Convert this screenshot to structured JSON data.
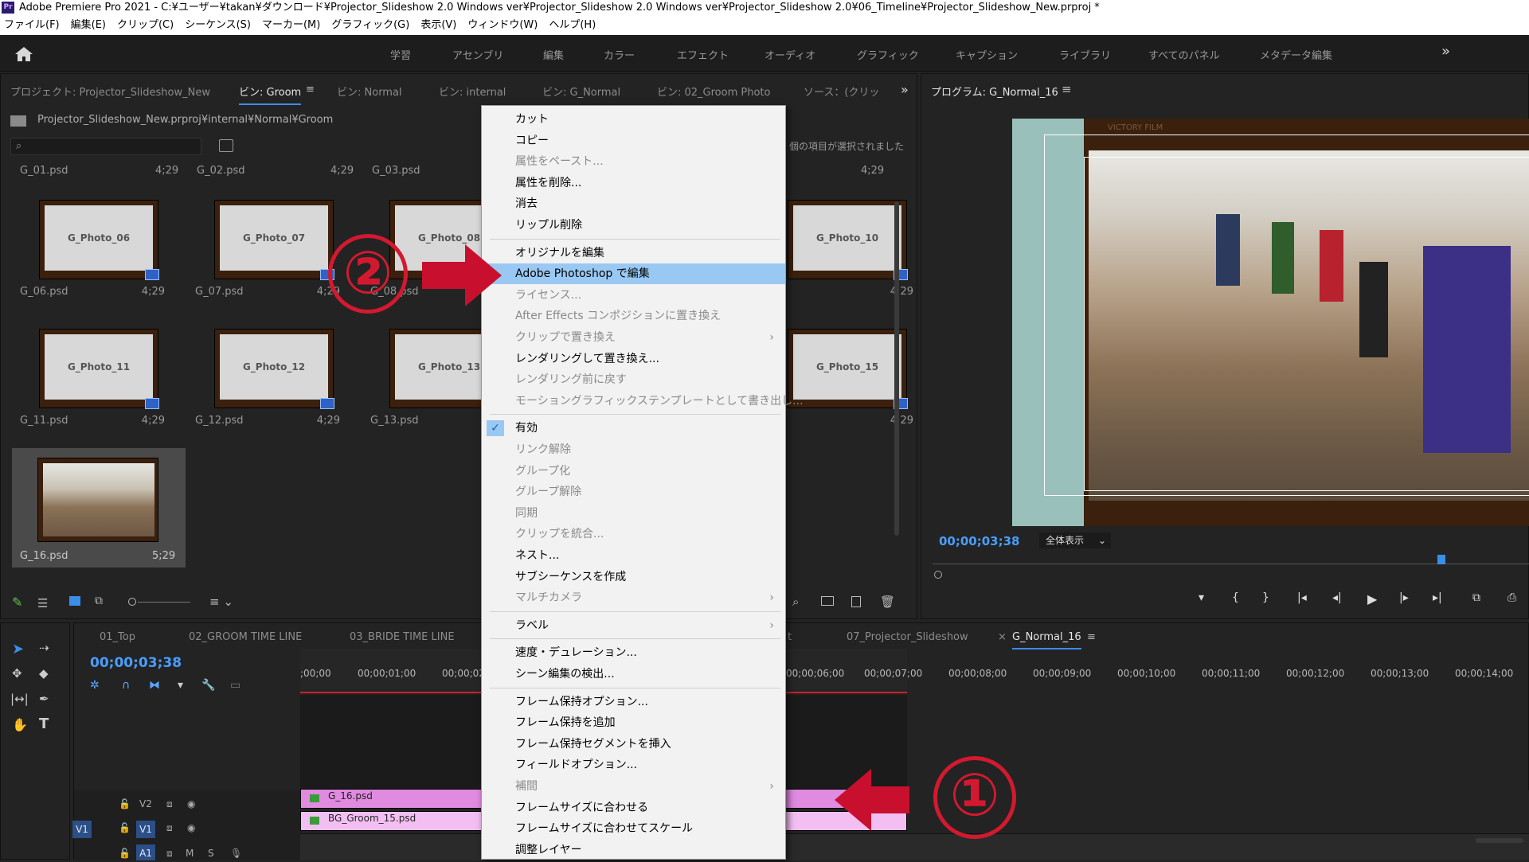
{
  "window": {
    "title": "Adobe Premiere Pro 2021 - C:¥ユーザー¥takan¥ダウンロード¥Projector_Slideshow 2.0 Windows ver¥Projector_Slideshow 2.0 Windows ver¥Projector_Slideshow 2.0¥06_Timeline¥Projector_Slideshow_New.prproj *",
    "app_badge": "Pr"
  },
  "menubar": [
    "ファイル(F)",
    "編集(E)",
    "クリップ(C)",
    "シーケンス(S)",
    "マーカー(M)",
    "グラフィック(G)",
    "表示(V)",
    "ウィンドウ(W)",
    "ヘルプ(H)"
  ],
  "workspaces": [
    "学習",
    "アセンブリ",
    "編集",
    "カラー",
    "エフェクト",
    "オーディオ",
    "グラフィック",
    "キャプション",
    "ライブラリ",
    "すべてのパネル",
    "メタデータ編集"
  ],
  "ws_overflow": "»",
  "project": {
    "tabs": [
      "プロジェクト: Projector_Slideshow_New",
      "ビン: Groom",
      "ビン: Normal",
      "ビン: internal",
      "ビン: G_Normal",
      "ビン: 02_Groom Photo",
      "ソース：(クリッ"
    ],
    "tabs_overflow": "»",
    "path": "Projector_Slideshow_New.prproj¥internal¥Normal¥Groom",
    "selection_status": "個の項目が選択されました",
    "row0": [
      {
        "name": "G_01.psd",
        "dur": "4;29"
      },
      {
        "name": "G_02.psd",
        "dur": "4;29"
      },
      {
        "name": "G_03.psd",
        "dur": ""
      },
      {
        "name": "",
        "dur": "4;29"
      }
    ],
    "items": [
      {
        "label": "G_Photo_06",
        "name": "G_06.psd",
        "dur": "4;29"
      },
      {
        "label": "G_Photo_07",
        "name": "G_07.psd",
        "dur": "4;29"
      },
      {
        "label": "G_Photo_08",
        "name": "G_08.psd",
        "dur": ""
      },
      {
        "label": "G_Photo_10",
        "name": "",
        "dur": "4;29"
      },
      {
        "label": "G_Photo_11",
        "name": "G_11.psd",
        "dur": "4;29"
      },
      {
        "label": "G_Photo_12",
        "name": "G_12.psd",
        "dur": "4;29"
      },
      {
        "label": "G_Photo_13",
        "name": "G_13.psd",
        "dur": ""
      },
      {
        "label": "G_Photo_15",
        "name": "",
        "dur": "4;29"
      }
    ],
    "selected_item": {
      "name": "G_16.psd",
      "dur": "5;29"
    }
  },
  "program": {
    "title": "プログラム: G_Normal_16",
    "timecode": "00;00;03;38",
    "fit": "全体表示",
    "photo_caption": "VICTORY FILM"
  },
  "context_menu": [
    {
      "label": "カット",
      "state": "normal"
    },
    {
      "label": "コピー",
      "state": "normal"
    },
    {
      "label": "属性をペースト...",
      "state": "disabled"
    },
    {
      "label": "属性を削除...",
      "state": "normal"
    },
    {
      "label": "消去",
      "state": "normal"
    },
    {
      "label": "リップル削除",
      "state": "normal"
    },
    {
      "sep": true
    },
    {
      "label": "オリジナルを編集",
      "state": "normal"
    },
    {
      "label": "Adobe Photoshop で編集",
      "state": "highlight"
    },
    {
      "label": "ライセンス...",
      "state": "disabled"
    },
    {
      "label": "After Effects コンポジションに置き換え",
      "state": "disabled"
    },
    {
      "label": "クリップで置き換え",
      "state": "disabled",
      "submenu": true
    },
    {
      "label": "レンダリングして置き換え...",
      "state": "normal"
    },
    {
      "label": "レンダリング前に戻す",
      "state": "disabled"
    },
    {
      "label": "モーショングラフィックステンプレートとして書き出し...",
      "state": "disabled"
    },
    {
      "sep": true
    },
    {
      "label": "有効",
      "state": "checked"
    },
    {
      "label": "リンク解除",
      "state": "disabled"
    },
    {
      "label": "グループ化",
      "state": "disabled"
    },
    {
      "label": "グループ解除",
      "state": "disabled"
    },
    {
      "label": "同期",
      "state": "disabled"
    },
    {
      "label": "クリップを統合...",
      "state": "disabled"
    },
    {
      "label": "ネスト...",
      "state": "normal"
    },
    {
      "label": "サブシーケンスを作成",
      "state": "normal"
    },
    {
      "label": "マルチカメラ",
      "state": "disabled",
      "submenu": true
    },
    {
      "sep": true
    },
    {
      "label": "ラベル",
      "state": "normal",
      "submenu": true
    },
    {
      "sep": true
    },
    {
      "label": "速度・デュレーション...",
      "state": "normal"
    },
    {
      "label": "シーン編集の検出...",
      "state": "normal"
    },
    {
      "sep": true
    },
    {
      "label": "フレーム保持オプション...",
      "state": "normal"
    },
    {
      "label": "フレーム保持を追加",
      "state": "normal"
    },
    {
      "label": "フレーム保持セグメントを挿入",
      "state": "normal"
    },
    {
      "label": "フィールドオプション...",
      "state": "normal"
    },
    {
      "label": "補間",
      "state": "disabled",
      "submenu": true
    },
    {
      "label": "フレームサイズに合わせる",
      "state": "normal"
    },
    {
      "label": "フレームサイズに合わせてスケール",
      "state": "normal"
    },
    {
      "label": "調整レイヤー",
      "state": "normal"
    }
  ],
  "timeline": {
    "tabs": [
      "01_Top",
      "02_GROOM TIME LINE",
      "03_BRIDE TIME LINE",
      "t",
      "07_Projector_Slideshow",
      "G_Normal_16"
    ],
    "close_x": "×",
    "timecode": "00;00;03;38",
    "ruler": [
      ";00;00",
      "00;00;01;00",
      "00;00;02",
      "00;00;06;00",
      "00;00;07;00",
      "00;00;08;00",
      "00;00;09;00",
      "00;00;10;00",
      "00;00;11;00",
      "00;00;12;00",
      "00;00;13;00",
      "00;00;14;00"
    ],
    "tracks": {
      "v2": "V2",
      "v1": "V1",
      "a1": "A1",
      "src_v1": "V1",
      "m": "M",
      "s": "S"
    },
    "clips": {
      "v2": "G_16.psd",
      "v1": "BG_Groom_15.psd"
    }
  },
  "annotations": {
    "one": "①",
    "two": "②",
    "arrow_color": "#c8102e"
  }
}
